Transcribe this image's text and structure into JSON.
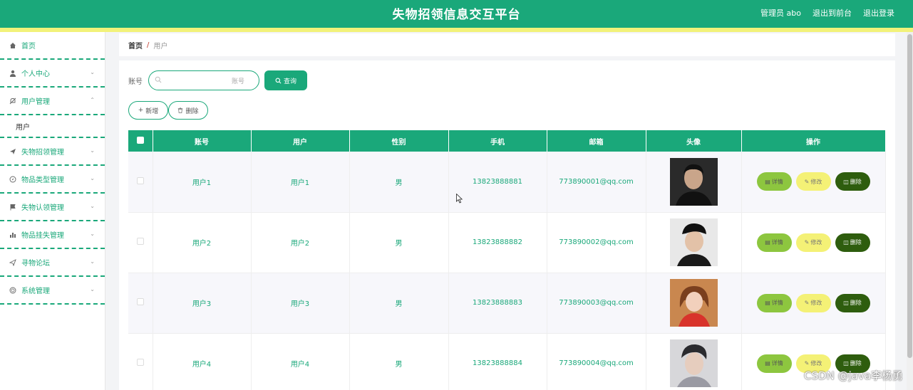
{
  "header": {
    "title": "失物招领信息交互平台",
    "admin": "管理员 abo",
    "to_front": "退出到前台",
    "logout": "退出登录"
  },
  "sidebar": {
    "items": [
      {
        "label": "首页",
        "icon": "home-icon"
      },
      {
        "label": "个人中心",
        "icon": "user-icon"
      },
      {
        "label": "用户管理",
        "icon": "bell-off-icon"
      },
      {
        "label": "失物招领管理",
        "icon": "send-icon"
      },
      {
        "label": "物品类型管理",
        "icon": "compass-icon"
      },
      {
        "label": "失物认领管理",
        "icon": "flag-icon"
      },
      {
        "label": "物品挂失管理",
        "icon": "bar-chart-icon"
      },
      {
        "label": "寻物论坛",
        "icon": "paper-plane-icon"
      },
      {
        "label": "系统管理",
        "icon": "globe-icon"
      }
    ],
    "sub_user": "用户"
  },
  "breadcrumb": {
    "home": "首页",
    "sep": "/",
    "current": "用户"
  },
  "search": {
    "label": "账号",
    "placeholder": "账号",
    "button": "查询"
  },
  "actions": {
    "add": "新增",
    "delete": "删除"
  },
  "table": {
    "headers": [
      "账号",
      "用户",
      "性别",
      "手机",
      "邮箱",
      "头像",
      "操作"
    ],
    "rows": [
      {
        "account": "用户1",
        "user": "用户1",
        "gender": "男",
        "phone": "13823888881",
        "email": "773890001@qq.com"
      },
      {
        "account": "用户2",
        "user": "用户2",
        "gender": "男",
        "phone": "13823888882",
        "email": "773890002@qq.com"
      },
      {
        "account": "用户3",
        "user": "用户3",
        "gender": "男",
        "phone": "13823888883",
        "email": "773890003@qq.com"
      },
      {
        "account": "用户4",
        "user": "用户4",
        "gender": "男",
        "phone": "13823888884",
        "email": "773890004@qq.com"
      }
    ],
    "op_detail": "详情",
    "op_edit": "修改",
    "op_delete": "删除"
  },
  "watermark": "CSDN @java李杨勇",
  "colors": {
    "primary": "#1aa87a",
    "accent_strip": "#f2f27a",
    "detail": "#8dc63f",
    "edit": "#f4f176",
    "delete": "#2e5d0e"
  }
}
